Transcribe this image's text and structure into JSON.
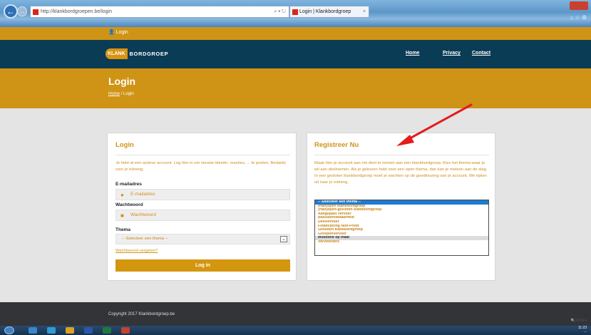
{
  "browser": {
    "url": "http://klankbordgroepen.be/login",
    "tab_title": "Login | Klankbordgroep",
    "address_controls": "⌕ ▾ ↻",
    "tab_close": "×"
  },
  "topbar": {
    "login_link": "👤 Login"
  },
  "header": {
    "logo_klank": "KLANK",
    "logo_bord": "BORDGROEP",
    "nav": [
      "Home",
      "Privacy",
      "Contact"
    ]
  },
  "titleband": {
    "title": "Login",
    "breadcrumb_home": "Home",
    "breadcrumb_sep": "/",
    "breadcrumb_current": "Login"
  },
  "login_panel": {
    "heading": "Login",
    "intro": "Je hebt al een actieve account. Log hier in om nieuwe ideeën, reacties, ... te posten. Bedankt voor je inbreng.",
    "email_label": "E-mailadres",
    "email_placeholder": "E-mailadres",
    "password_label": "Wachtwoord",
    "password_placeholder": "Wachtwoord",
    "theme_label": "Thema",
    "theme_selected": "-- Selecteer een thema --",
    "forgot_link": "Wachtwoord vergeten?",
    "login_button": "Log in"
  },
  "register_panel": {
    "heading": "Registreer Nu",
    "intro": "Maak hier je account aan om deel te nemen aan een klankbordgroep. Kies het thema waar je wil aan deelnemen. Als je gekozen hebt voor een open thema, dan kan je meteen aan de slag. In een gesloten klankbordgroep moet je wachten op de goedkeuring van je account. We kijken uit naar je inbreng.",
    "options": [
      "-- Selecteer een thema --",
      "(Half)open klankbordgroep",
      "(Half)open-gesloten klankbordgroep",
      "Aangepast vervoer",
      "Basisbereikbaarheid",
      "Deelvervoer",
      "Financiering Non-Profit",
      "Gesloten klankbordgroep",
      "Groepenvervoer",
      "Mobiliteit op maat",
      "Vervoerders"
    ],
    "selected_index": 0,
    "hovered_index": 9
  },
  "footer": {
    "copyright": "Copyright 2017 Klankbordgroep.be"
  },
  "status": {
    "zoom": "🔍110% ▾",
    "clock_time": "11:23",
    "clock_date": "..."
  },
  "colors": {
    "gold": "#cf9416",
    "navy": "#0b3c55",
    "annotation_arrow": "#e31c1c"
  }
}
